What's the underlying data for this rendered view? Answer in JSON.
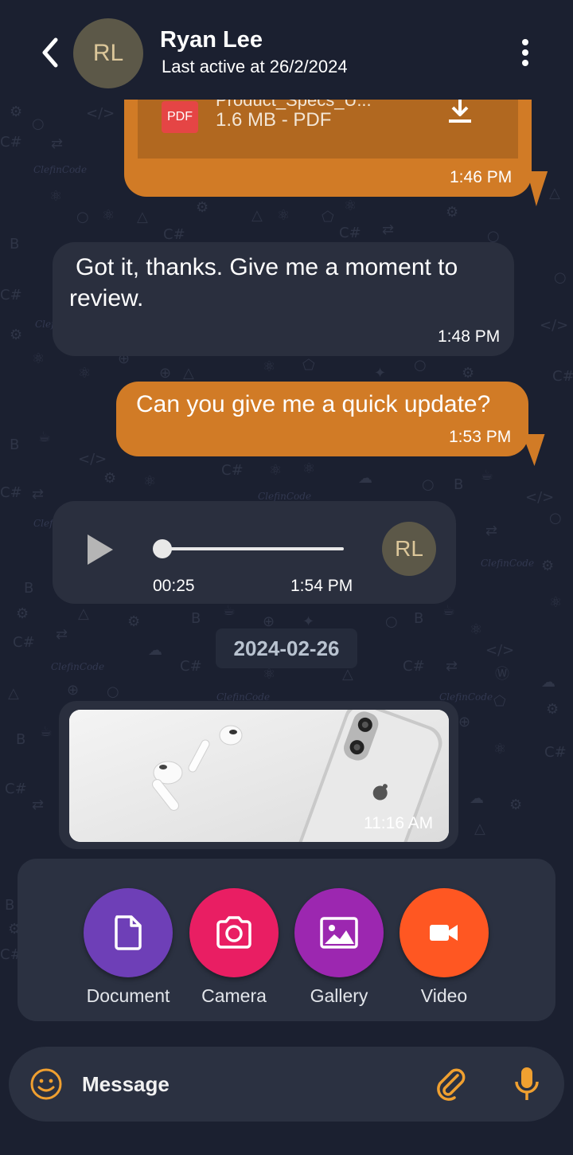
{
  "header": {
    "avatar_initials": "RL",
    "contact_name": "Ryan Lee",
    "status": "Last active at 26/2/2024"
  },
  "messages": {
    "pdf": {
      "file_name": "Product_Specs_U...",
      "file_meta": "1.6 MB - PDF",
      "badge": "PDF",
      "time": "1:46 PM"
    },
    "incoming_text": {
      "text": "Got it, thanks. Give me a moment to review.",
      "time": "1:48 PM"
    },
    "outgoing_text": {
      "text": "Can you give me a quick update?",
      "time": "1:53 PM"
    },
    "voice": {
      "duration": "00:25",
      "time": "1:54 PM",
      "avatar_initials": "RL",
      "progress": 0
    },
    "date_separator": "2024-02-26",
    "image": {
      "time": "11:16 AM"
    }
  },
  "attachments": [
    {
      "label": "Document",
      "color": "#6e3fb7",
      "icon": "document-icon"
    },
    {
      "label": "Camera",
      "color": "#e91e63",
      "icon": "camera-icon"
    },
    {
      "label": "Gallery",
      "color": "#9c27b0",
      "icon": "gallery-icon"
    },
    {
      "label": "Video",
      "color": "#ff5722",
      "icon": "video-icon"
    }
  ],
  "composer": {
    "placeholder": "Message"
  },
  "colors": {
    "background": "#1b2030",
    "outgoing_bubble": "#d17b26",
    "incoming_bubble": "#2a2f3e",
    "accent": "#f0a030"
  }
}
